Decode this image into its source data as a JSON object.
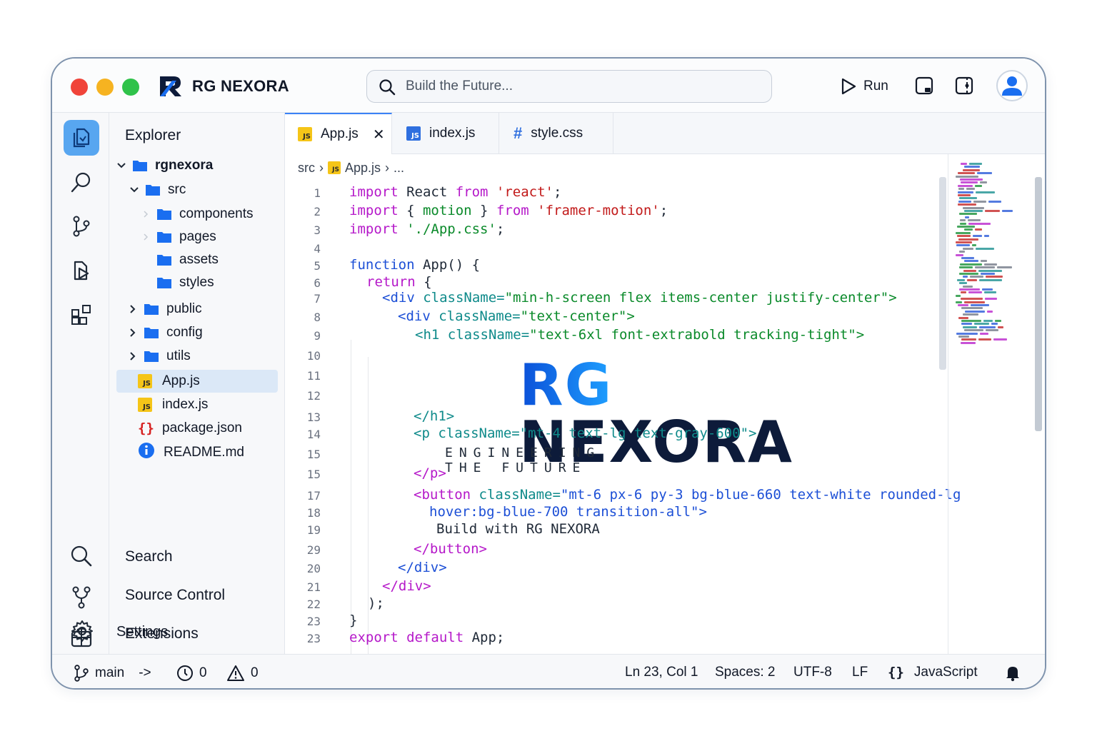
{
  "app": {
    "name": "RG NEXORA"
  },
  "search": {
    "placeholder": "Build the Future..."
  },
  "toolbar": {
    "run_label": "Run"
  },
  "explorer": {
    "title": "Explorer",
    "tree": [
      {
        "label": "rgnexora",
        "type": "folder",
        "expanded": true
      },
      {
        "label": "src",
        "type": "folder",
        "expanded": true
      },
      {
        "label": "components",
        "type": "folder"
      },
      {
        "label": "pages",
        "type": "folder"
      },
      {
        "label": "assets",
        "type": "folder"
      },
      {
        "label": "styles",
        "type": "folder"
      },
      {
        "label": "public",
        "type": "folder"
      },
      {
        "label": "config",
        "type": "folder"
      },
      {
        "label": "utils",
        "type": "folder"
      },
      {
        "label": "App.js",
        "type": "js",
        "selected": true
      },
      {
        "label": "index.js",
        "type": "js"
      },
      {
        "label": "package.json",
        "type": "json"
      },
      {
        "label": "README.md",
        "type": "info"
      }
    ]
  },
  "panels": {
    "search": "Search",
    "source_control": "Source Control",
    "extensions": "Extensions",
    "settings": "Settings"
  },
  "tabs": [
    {
      "label": "App.js",
      "badge": "JS",
      "active": true
    },
    {
      "label": "index.js",
      "badge": "JS"
    },
    {
      "label": "style.css",
      "badge": "#"
    }
  ],
  "breadcrumb": {
    "folder": "src",
    "file": "App.js",
    "more": "..."
  },
  "line_numbers": [
    "1",
    "2",
    "3",
    "4",
    "5",
    "6",
    "7",
    "8",
    "9",
    "10",
    "11",
    "12",
    "13",
    "14",
    "15",
    "15",
    "17",
    "18",
    "19",
    "29",
    "20",
    "21",
    "22",
    "23",
    "23"
  ],
  "code": {
    "l1": {
      "k1": "import",
      "t1": " React ",
      "k2": "from",
      "s": " 'react'",
      "e": ";"
    },
    "l2": {
      "k1": "import",
      "t1": " { ",
      "g": "motion",
      "t2": " } ",
      "k2": "from",
      "s": " 'framer-motion'",
      "e": ";"
    },
    "l3": {
      "k1": "import",
      "g": " './App.css'",
      "e": ";"
    },
    "l5": {
      "k": "function",
      "t": " App() {"
    },
    "l6": {
      "k": "return",
      "t": " {"
    },
    "l7": {
      "tag": "<div",
      "attr": " className=",
      "val": "\"min-h-screen flex items-center justify-center\">"
    },
    "l8": {
      "tag": "<div",
      "attr": " className=",
      "val": "\"text-center\">"
    },
    "l9": {
      "tag": "<h1",
      "attr": " className=",
      "val": "\"text-6xl font-extrabold tracking-tight\">"
    },
    "hero_rg": "RG",
    "hero_nx": "NEXORA",
    "l13": "</h1>",
    "l14": {
      "tag": "<p",
      "attr": " className=",
      "val": "\"mt-4 text-lg text-gray-600\">"
    },
    "tagline": "ENGINEERING THE FUTURE",
    "l16": "</p>",
    "l17": {
      "tag": "<button",
      "attr": " className=",
      "val": "\"mt-6 px-6 py-3 bg-blue-660 text-white rounded-lg"
    },
    "l18": "hover:bg-blue-700 transition-all\">",
    "l19": "Build with RG NEXORA",
    "l20": "</button>",
    "l21": "</div>",
    "l22": "</div>",
    "l23": ");",
    "l24": "}",
    "l25": {
      "k": "export default",
      "t": " App;"
    }
  },
  "status": {
    "branch": "main",
    "sync": "->",
    "errors": "0",
    "warnings": "0",
    "position": "Ln 23, Col 1",
    "spaces": "Spaces: 2",
    "encoding": "UTF-8",
    "eol": "LF",
    "language_icon": "{}",
    "language": "JavaScript"
  },
  "colors": {
    "accent": "#3b82f6",
    "keyword": "#b518c9",
    "string": "#c21a1a",
    "tag": "#1c4fd6",
    "attribute": "#0e8a8a"
  }
}
